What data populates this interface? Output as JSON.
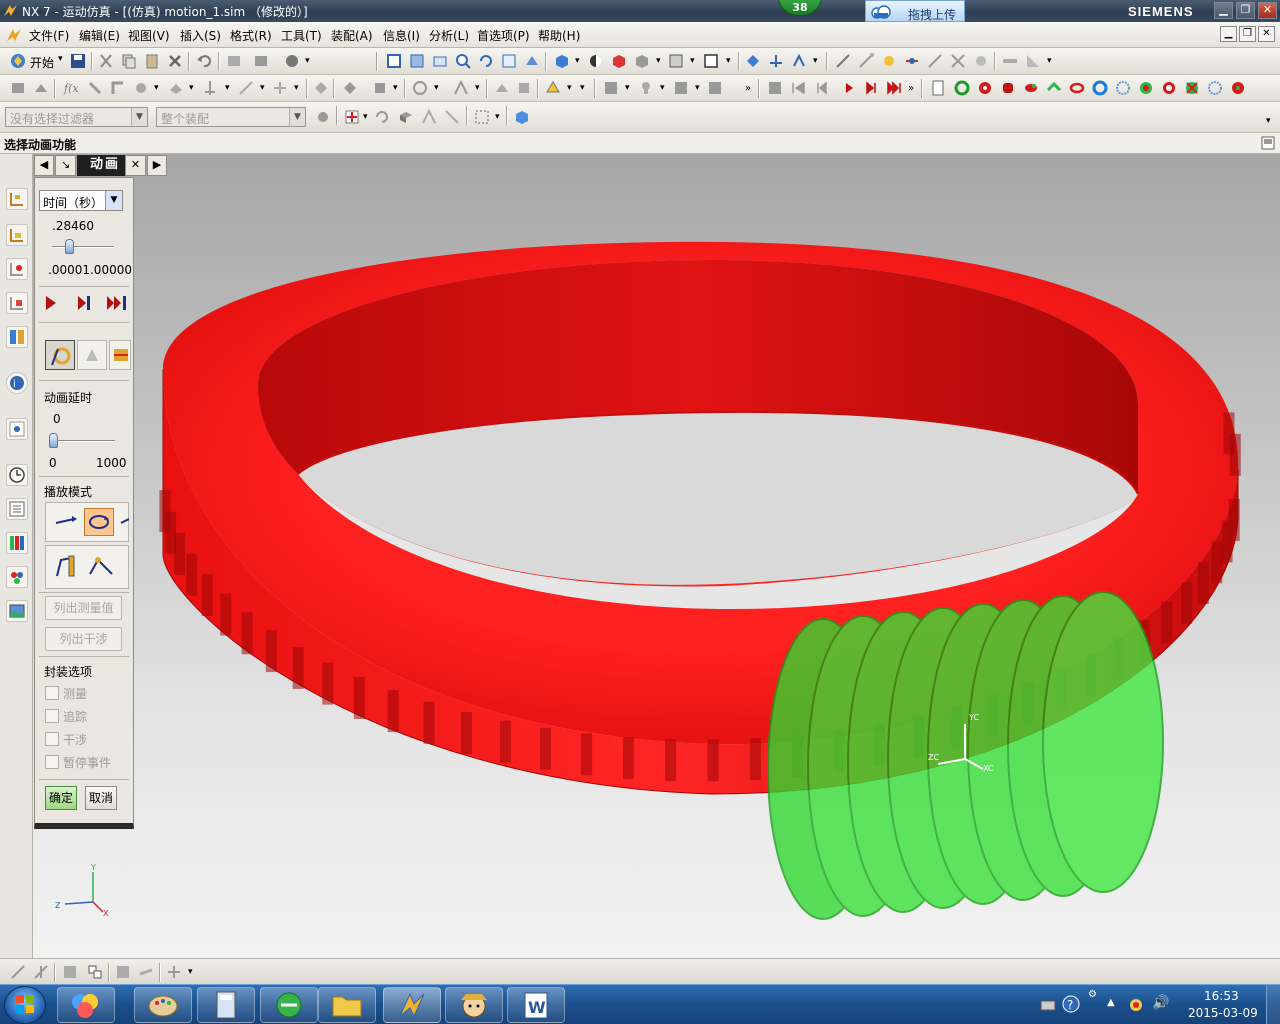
{
  "window": {
    "title": "NX 7 - 运动仿真 - [(仿真) motion_1.sim （修改的）]",
    "notification_count": "38",
    "upload_label": "拖拽上传",
    "brand": "SIEMENS",
    "controls": [
      "▁",
      "❐",
      "✕"
    ]
  },
  "menu": {
    "items": [
      "文件(F)",
      "编辑(E)",
      "视图(V)",
      "插入(S)",
      "格式(R)",
      "工具(T)",
      "装配(A)",
      "信息(I)",
      "分析(L)",
      "首选项(P)",
      "帮助(H)"
    ]
  },
  "toolbar": {
    "start_label": "开始",
    "filter_placeholder": "没有选择过滤器",
    "assembly_scope": "整个装配"
  },
  "cue_line": "选择动画功能",
  "animation_panel": {
    "tab_title": "动画",
    "time_unit": "时间（秒）",
    "time_value": ".28460",
    "time_range": ".00001.00000",
    "time_level": 0.28,
    "delay_label": "动画延时",
    "delay_value": "0",
    "delay_min": "0",
    "delay_max": "1000",
    "delay_level": 0.0,
    "playback_mode_label": "播放模式",
    "list_measurements": "列出测量值",
    "list_interference": "列出干涉",
    "package_options_label": "封装选项",
    "checkboxes": [
      "测量",
      "追踪",
      "干涉",
      "暂停事件"
    ],
    "ok": "确定",
    "cancel": "取消"
  },
  "axis_labels": {
    "triad_z": "Z",
    "triad_y": "Y",
    "triad_x": "X",
    "wcs_yc_top": "YC",
    "wcs_zc": "ZC",
    "wcs_xc": "XC"
  },
  "colors": {
    "gear": "#ff1a1a",
    "worm": "#33e033"
  },
  "clock": {
    "time": "16:53",
    "date": "2015-03-09"
  }
}
